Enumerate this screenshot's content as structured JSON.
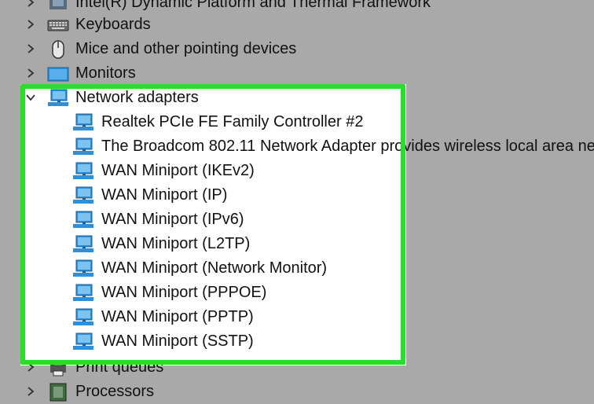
{
  "colors": {
    "background": "#a9a9a9",
    "panel": "#ffffff",
    "highlight": "#2bdc2b",
    "icon_blue": "#2f8fd8"
  },
  "tree": {
    "top_items": [
      {
        "label": "Intel(R) Dynamic Platform and Thermal Framework",
        "icon": "chip-icon",
        "expanded": false
      },
      {
        "label": "Keyboards",
        "icon": "keyboard-icon",
        "expanded": false
      },
      {
        "label": "Mice and other pointing devices",
        "icon": "mouse-icon",
        "expanded": false
      },
      {
        "label": "Monitors",
        "icon": "monitor-icon",
        "expanded": false
      }
    ],
    "network": {
      "label": "Network adapters",
      "icon": "network-adapter-icon",
      "expanded": true,
      "children": [
        "Realtek PCIe FE Family Controller #2",
        "The Broadcom 802.11 Network Adapter provides wireless local area ne",
        "WAN Miniport (IKEv2)",
        "WAN Miniport (IP)",
        "WAN Miniport (IPv6)",
        "WAN Miniport (L2TP)",
        "WAN Miniport (Network Monitor)",
        "WAN Miniport (PPPOE)",
        "WAN Miniport (PPTP)",
        "WAN Miniport (SSTP)"
      ]
    },
    "bottom_items": [
      {
        "label": "Print queues",
        "icon": "printer-icon",
        "expanded": false
      },
      {
        "label": "Processors",
        "icon": "processor-icon",
        "expanded": false
      }
    ]
  }
}
